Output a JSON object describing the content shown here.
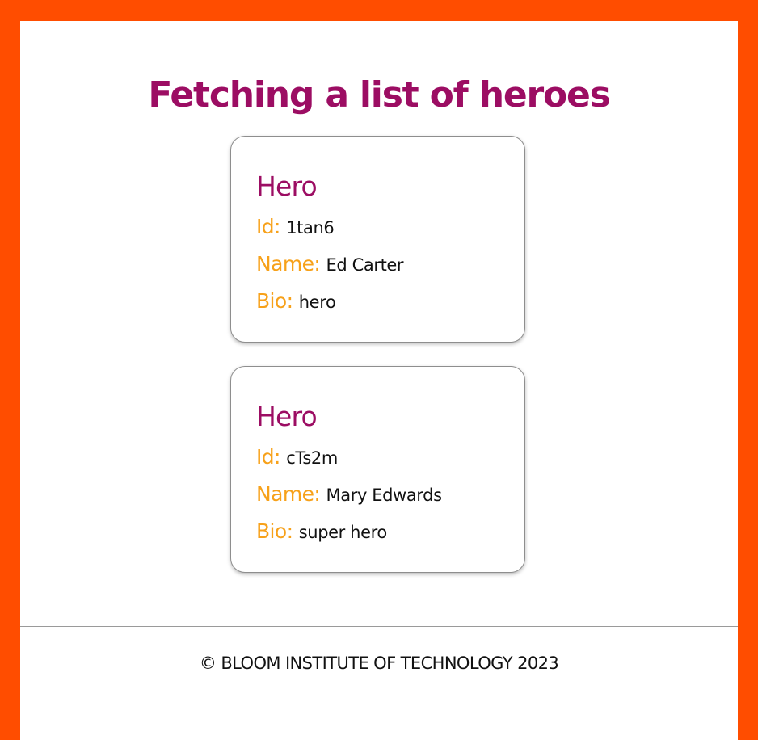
{
  "page": {
    "title": "Fetching a list of heroes",
    "background_color": "#ff4d00",
    "title_color": "#9c0d63",
    "label_color": "#f7a11a"
  },
  "labels": {
    "id": "Id:",
    "name": "Name:",
    "bio": "Bio:"
  },
  "heroes": [
    {
      "title": "Hero",
      "id": "1tan6",
      "name": "Ed Carter",
      "bio": "hero"
    },
    {
      "title": "Hero",
      "id": "cTs2m",
      "name": "Mary Edwards",
      "bio": "super hero"
    }
  ],
  "footer": {
    "text": "© BLOOM INSTITUTE OF TECHNOLOGY 2023"
  }
}
